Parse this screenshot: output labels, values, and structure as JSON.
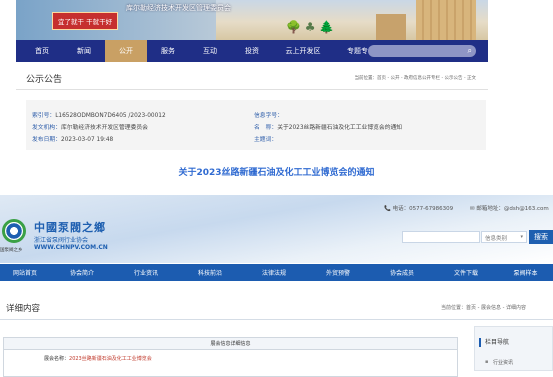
{
  "top_site": {
    "banner": {
      "slogan": "宜了就干 干就干好",
      "gov_title": "库尔勒经济技术开发区管理委员会",
      "trees": "🌳 ♣ 🌲"
    },
    "nav": [
      {
        "label": "首页"
      },
      {
        "label": "新闻"
      },
      {
        "label": "公开",
        "active": true
      },
      {
        "label": "服务"
      },
      {
        "label": "互动"
      },
      {
        "label": "投资"
      },
      {
        "label": "云上开发区"
      },
      {
        "label": "专题专栏"
      }
    ],
    "search_glass": "⌕",
    "section_title": "公示公告",
    "breadcrumb": "当前位置：首页 - 公开 - 政府信息公开专栏 - 公示公告 - 正文",
    "meta": {
      "index_label": "索引号：",
      "index_value": "L16528ODMBON7D6405 /2023-00012",
      "info_class_label": "信息字号：",
      "info_class_value": "",
      "org_label": "发文机构：",
      "org_value": "库尔勒经济技术开发区管理委员会",
      "name_label": "名　称：",
      "name_value": "关于2023丝路新疆石油及化工工业博览会的通知",
      "date_label": "发布日期：",
      "date_value": "2023-03-07 19:48",
      "topic_label": "主题词：",
      "topic_value": ""
    },
    "doc_title": "关于2023丝路新疆石油及化工工业博览会的通知"
  },
  "bottom_site": {
    "logo": {
      "cn": "中國泵閥之鄉",
      "assoc": "浙江省泵阀行业协会",
      "url": "WWW.CHNPV.COM.CN",
      "sub": "国泵阀之乡"
    },
    "phone_label": "📞 电话：0577-67986309",
    "mail_label": "✉ 邮箱地址：@dsh@163.com",
    "search_placeholder": "",
    "category": "信息类别",
    "category_arrow": "▾",
    "search_button": "搜索",
    "nav": [
      {
        "label": "网站首页"
      },
      {
        "label": "协会简介"
      },
      {
        "label": "行业资讯"
      },
      {
        "label": "科技前沿"
      },
      {
        "label": "法律法规"
      },
      {
        "label": "外贸预警"
      },
      {
        "label": "协会成员"
      },
      {
        "label": "文件下载"
      },
      {
        "label": "泵阀样本"
      }
    ],
    "detail_title": "详细内容",
    "breadcrumb": "当前位置：首页 - 展会信息 - 详细内容",
    "table_head": "展会信息详细信息",
    "exhibit_label": "展会名称：",
    "exhibit_value": "2023丝路新疆石油及化工工业博览会",
    "side_title": "栏目导航",
    "side_item": "行业资讯",
    "side_item_icon": "▪"
  }
}
